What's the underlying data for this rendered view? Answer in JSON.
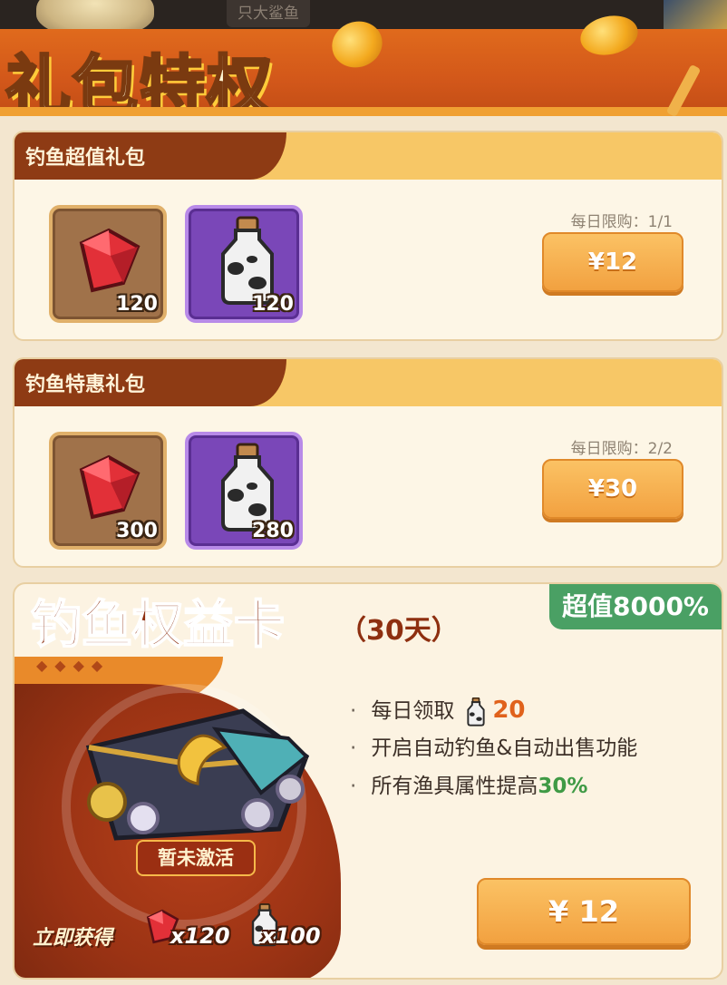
{
  "header": {
    "title": "礼包特权",
    "top_hint": "只大鲨鱼"
  },
  "packages": [
    {
      "name": "钓鱼超值礼包",
      "items": [
        {
          "icon": "ruby-gem-icon",
          "count": "120"
        },
        {
          "icon": "milk-bottle-icon",
          "count": "120"
        }
      ],
      "limit": "每日限购：1/1",
      "price": "¥12"
    },
    {
      "name": "钓鱼特惠礼包",
      "items": [
        {
          "icon": "ruby-gem-icon",
          "count": "300"
        },
        {
          "icon": "milk-bottle-icon",
          "count": "280"
        }
      ],
      "limit": "每日限购：2/2",
      "price": "¥30"
    }
  ],
  "card": {
    "title": "钓鱼权益卡",
    "duration": "（30天）",
    "value_badge": "超值8000%",
    "status": "暂未激活",
    "instant_label": "立即获得",
    "instant_rewards": [
      {
        "icon": "ruby-gem-icon",
        "count": "x120"
      },
      {
        "icon": "milk-bottle-icon",
        "count": "x100"
      }
    ],
    "benefits": {
      "daily_claim_prefix": "每日领取",
      "daily_claim_amount": "20",
      "auto_feature": "开启自动钓鱼&自动出售功能",
      "gear_boost_prefix": "所有渔具属性提高",
      "gear_boost_value": "30%"
    },
    "price": "¥ 12"
  },
  "colors": {
    "accent_orange": "#f2a140",
    "header_orange": "#d2571a",
    "band_brown": "#8e3b14",
    "value_green": "#4aa064",
    "highlight_orange": "#e0621c",
    "highlight_green": "#3f9a45"
  }
}
